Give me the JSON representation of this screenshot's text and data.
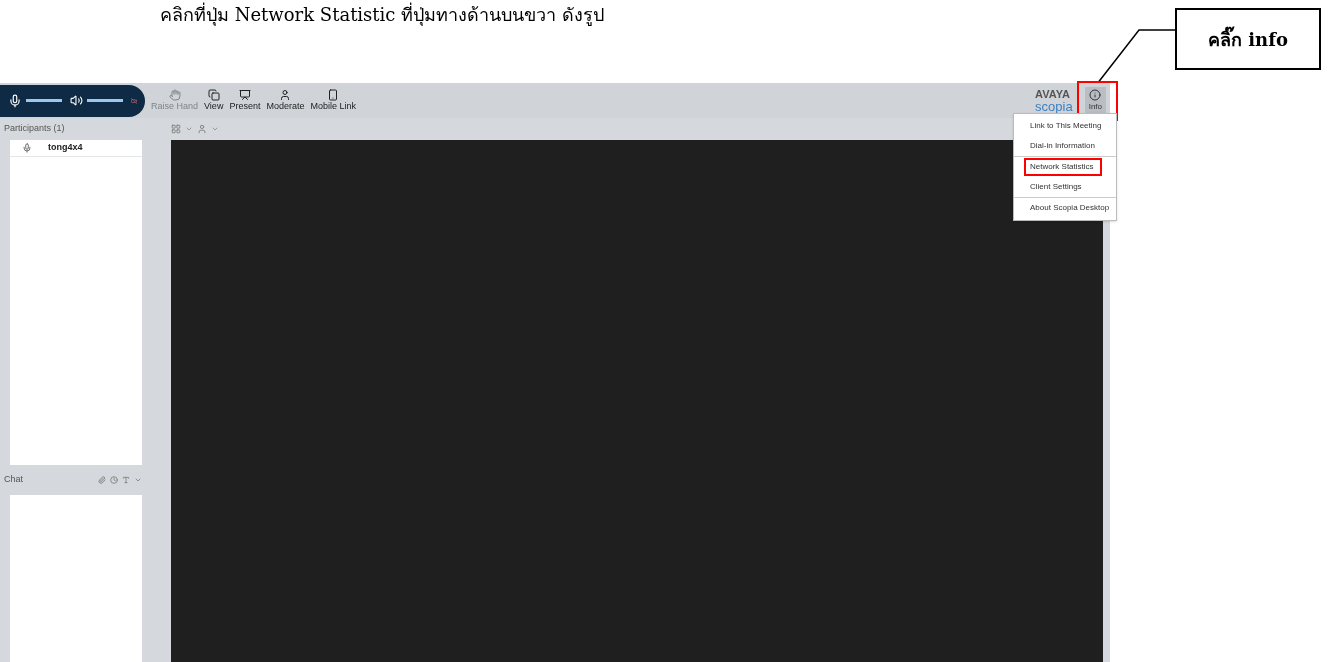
{
  "instruction": "คลิกที่ปุ่ม Network Statistic ที่ปุ่มทางด้านบนขวา ดังรูป",
  "callout": {
    "text": "คลิ๊ก info"
  },
  "media_controls": [
    {
      "kind": "mic",
      "level": 1
    },
    {
      "kind": "speaker",
      "level": 1
    },
    {
      "kind": "camera",
      "off": true
    }
  ],
  "toolbar": [
    {
      "kind": "hand",
      "label": "Raise Hand",
      "disabled": true
    },
    {
      "kind": "view",
      "label": "View",
      "disabled": false
    },
    {
      "kind": "present",
      "label": "Present",
      "disabled": false
    },
    {
      "kind": "moderate",
      "label": "Moderate",
      "disabled": false
    },
    {
      "kind": "mobile",
      "label": "Mobile Link",
      "disabled": false
    }
  ],
  "brand": {
    "line1": "AVAYA",
    "line2": "scopia"
  },
  "info_button": {
    "label": "Info",
    "highlighted": true
  },
  "participants": {
    "title": "Participants (1)",
    "items": [
      {
        "name": "tong4x4"
      }
    ]
  },
  "chat": {
    "title": "Chat"
  },
  "menu": [
    {
      "label": "Link to This Meeting",
      "divider_before": false,
      "highlighted": false
    },
    {
      "label": "Dial-in Information",
      "divider_before": false,
      "highlighted": false
    },
    {
      "label": "Network Statistics",
      "divider_before": true,
      "highlighted": true
    },
    {
      "label": "Client Settings",
      "divider_before": false,
      "highlighted": false
    },
    {
      "label": "About Scopia Desktop",
      "divider_before": true,
      "highlighted": false
    }
  ]
}
